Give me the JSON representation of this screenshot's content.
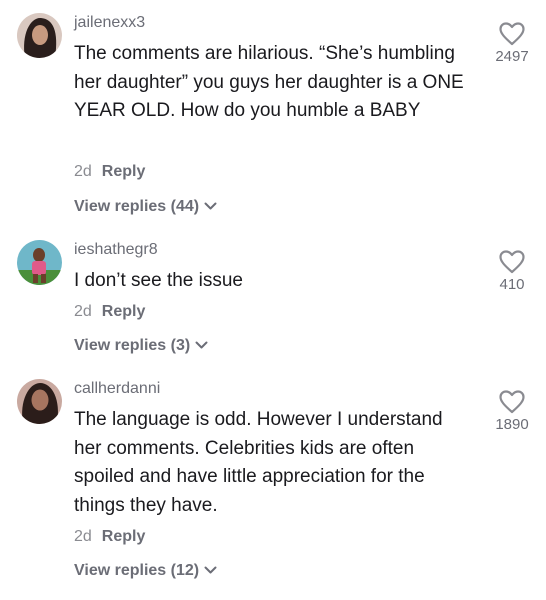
{
  "comments": [
    {
      "username": "jailenexx3",
      "text": "The comments are hilarious. “She’s humbling her daughter” you guys her daughter is a ONE YEAR OLD. How do you humble a BABY",
      "time": "2d",
      "reply_label": "Reply",
      "view_replies": "View replies (44)",
      "likes": "2497",
      "avatar_icon": "profile-photo"
    },
    {
      "username": "ieshathegr8",
      "text": "I don’t see the issue",
      "time": "2d",
      "reply_label": "Reply",
      "view_replies": "View replies (3)",
      "likes": "410",
      "avatar_icon": "profile-photo"
    },
    {
      "username": "callherdanni",
      "text": "The language is odd. However I understand her comments. Celebrities kids are often spoiled and have little appreciation for the things they have.",
      "time": "2d",
      "reply_label": "Reply",
      "view_replies": "View replies (12)",
      "likes": "1890",
      "avatar_icon": "profile-photo"
    }
  ],
  "colors": {
    "text": "#1a1a1e",
    "secondary": "#6b6d76",
    "timestamp": "#8a8b91"
  }
}
